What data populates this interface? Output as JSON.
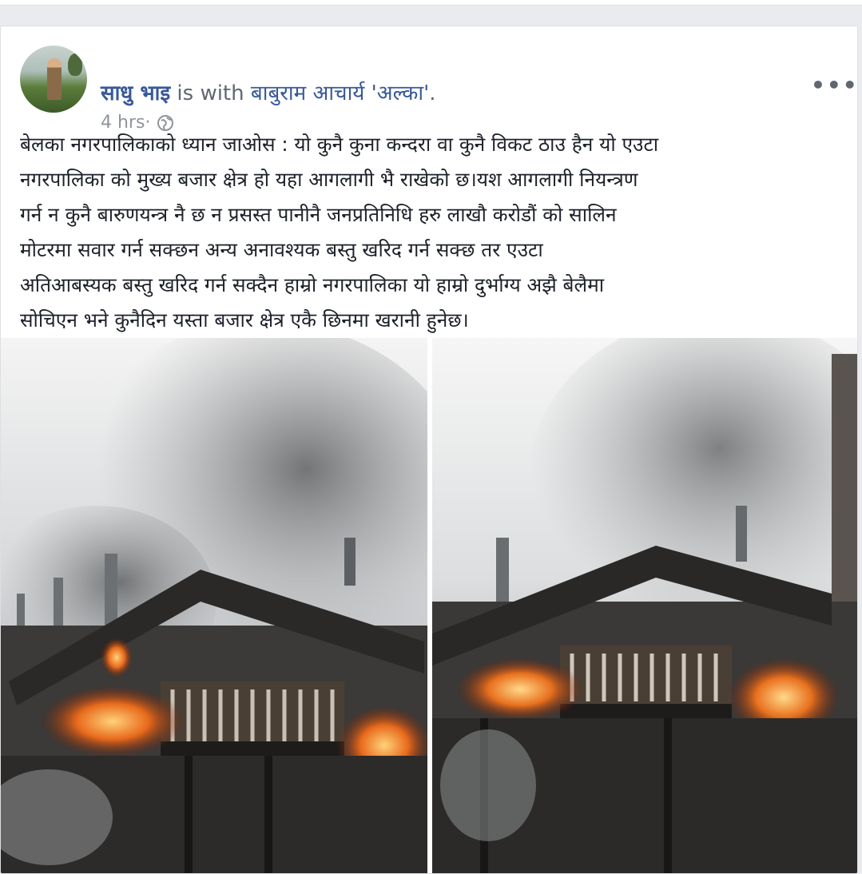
{
  "post": {
    "author": "साधु भाइ",
    "with_text": " is with ",
    "tagged": "बाबुराम आचार्य 'अल्का'",
    "tagged_suffix": ".",
    "time": "4 hrs",
    "separator": " · ",
    "privacy_icon": "globe-icon",
    "more_icon": "more-options-icon",
    "more_label": "•••",
    "text": "बेलका नगरपालिकाको ध्यान जाओस : यो कुनै कुना कन्दरा वा कुनै विकट ठाउ हैन यो एउटा\nनगरपालिका को मुख्य बजार क्षेत्र हो यहा आगलागी भै राखेको छ।यश आगलागी नियन्त्रण\nगर्न न कुनै बारुणयन्त्र नै छ न प्रसस्त पानीनै जनप्रतिनिधि हरु लाखौ करोडौं को सालिन\nमोटरमा सवार गर्न सक्छन अन्य अनावश्यक बस्तु खरिद गर्न सक्छ तर एउटा\nअतिआबस्यक बस्तु खरिद गर्न सक्दैन हाम्रो नगरपालिका यो हाम्रो दुर्भाग्य अझै बेलैमा\nसोचिएन भने कुनैदिन यस्ता बजार क्षेत्र एकै छिनमा खरानी हुनेछ।"
  },
  "colors": {
    "link": "#385898",
    "meta": "#90949c",
    "text": "#1d2129",
    "background": "#e9ebee",
    "card": "#ffffff"
  }
}
